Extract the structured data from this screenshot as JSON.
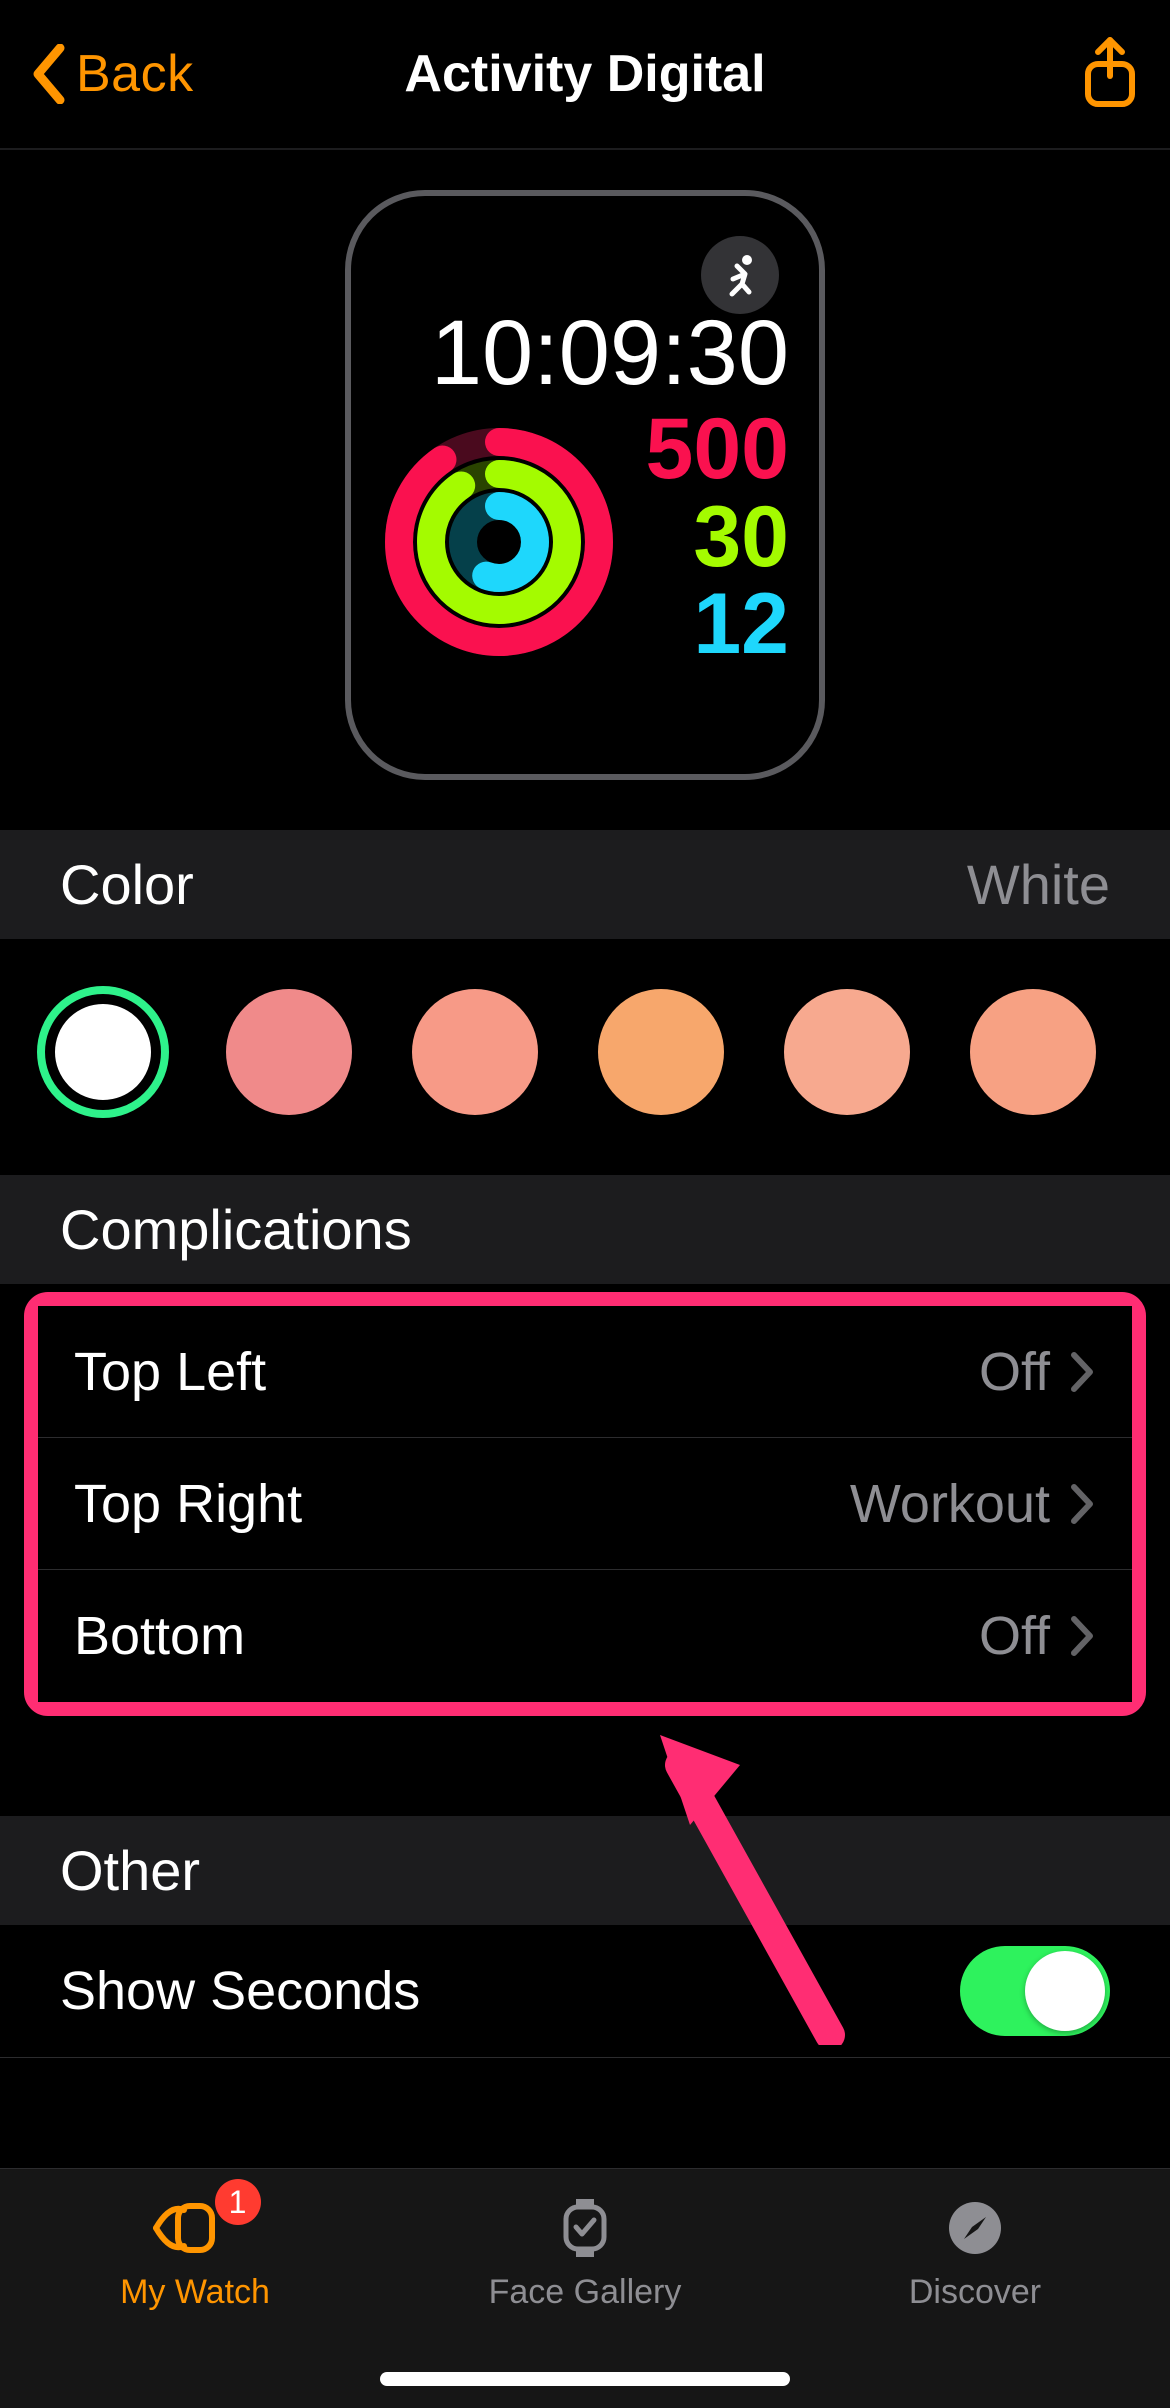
{
  "nav": {
    "back_label": "Back",
    "title": "Activity Digital"
  },
  "watchface": {
    "time": "10:09:30",
    "metrics": {
      "move": "500",
      "exercise": "30",
      "stand": "12"
    },
    "rings": {
      "move_color": "#fa114f",
      "exercise_color": "#a4fb00",
      "stand_color": "#1ed7fc"
    },
    "corner_icon": "workout-icon"
  },
  "color_section": {
    "label": "Color",
    "selected_name": "White",
    "swatches": [
      {
        "color": "#ffffff",
        "selected": true
      },
      {
        "color": "#f08a8a",
        "selected": false
      },
      {
        "color": "#f79a87",
        "selected": false
      },
      {
        "color": "#f7a76c",
        "selected": false
      },
      {
        "color": "#f7a98f",
        "selected": false
      },
      {
        "color": "#f7a183",
        "selected": false
      }
    ]
  },
  "complications_section": {
    "label": "Complications",
    "rows": [
      {
        "label": "Top Left",
        "value": "Off"
      },
      {
        "label": "Top Right",
        "value": "Workout"
      },
      {
        "label": "Bottom",
        "value": "Off"
      }
    ]
  },
  "other_section": {
    "label": "Other",
    "show_seconds_label": "Show Seconds",
    "show_seconds_on": true
  },
  "tabbar": {
    "tabs": [
      {
        "label": "My Watch",
        "active": true,
        "badge": "1"
      },
      {
        "label": "Face Gallery",
        "active": false
      },
      {
        "label": "Discover",
        "active": false
      }
    ]
  },
  "annotation": {
    "highlight_color": "#ff2d73"
  }
}
